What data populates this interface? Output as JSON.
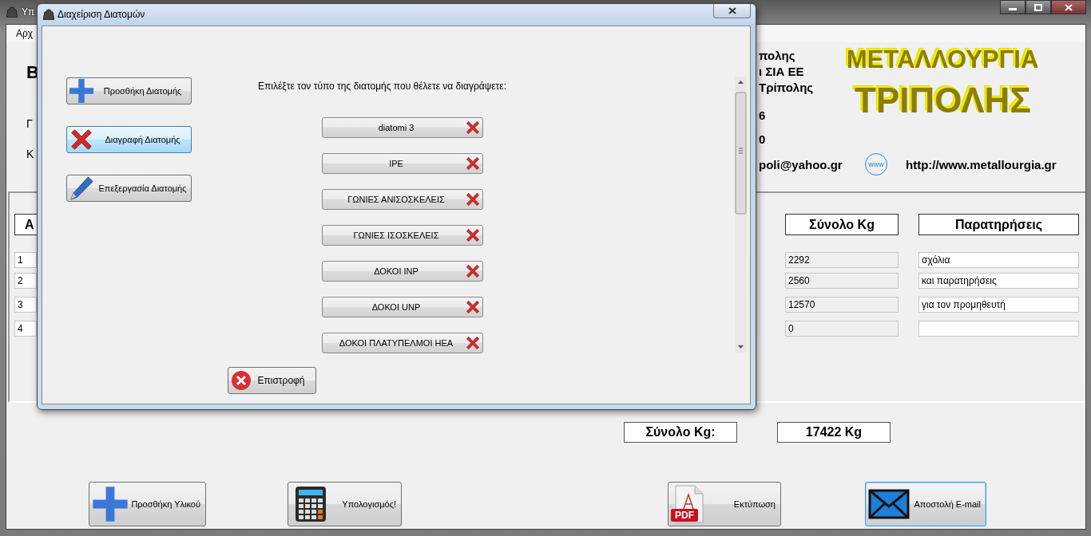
{
  "main_window": {
    "title": "Υπ",
    "menu": [
      "Αρχ"
    ],
    "header_letters": [
      "Β",
      "Γ",
      "Κ"
    ],
    "company_lines": [
      "πολης",
      "ι ΣΙΑ ΕΕ",
      "Τρίπολης",
      "6",
      "0"
    ],
    "email": "poli@yahoo.gr",
    "web_badge": "www",
    "website": "http://www.metallourgia.gr",
    "logo": [
      "ΜΕΤΑΛΛΟΥΡΓΙΑ",
      "ΤΡΙΠΟΛΗΣ"
    ]
  },
  "table": {
    "columns": [
      "Α",
      "Σύνολο Kg",
      "Παρατηρήσεις"
    ],
    "rows": [
      {
        "index": "1",
        "kg": "2292",
        "remarks": "σχόλια"
      },
      {
        "index": "2",
        "kg": "2560",
        "remarks": "και παρατηρήσεις"
      },
      {
        "index": "3",
        "kg": "12570",
        "remarks": "για τον προμηθευτή"
      },
      {
        "index": "4",
        "kg": "0"
      }
    ]
  },
  "totals": {
    "label": "Σύνολο Kg:",
    "value": "17422 Kg"
  },
  "buttons": [
    {
      "label": "Προσθήκη Υλικού",
      "kind": "add",
      "focused": false
    },
    {
      "label": "Υπολογισμός!",
      "kind": "calculate",
      "focused": false
    },
    {
      "label": "Εκτύπωση",
      "kind": "print",
      "badge": "PDF",
      "focused": false
    },
    {
      "label": "Αποστολή E-mail",
      "kind": "email",
      "focused": true
    }
  ],
  "dialog": {
    "title": "Διαχείριση Διατομών",
    "actions": [
      {
        "label": "Προσθήκη Διατομής",
        "kind": "add",
        "selected": false
      },
      {
        "label": "Διαγραφή Διατομής",
        "kind": "delete",
        "selected": true
      },
      {
        "label": "Επεξεργασία Διατομής",
        "kind": "edit",
        "selected": false
      }
    ],
    "prompt": "Επιλέξτε τον τύπο της διατομής που θέλετε να διαγράψετε:",
    "sections": [
      "diatomi 3",
      "IPE",
      "ΓΩΝΙΕΣ ΑΝΙΣΟΣΚΕΛΕΙΣ",
      "ΓΩΝΙΕΣ ΙΣΟΣΚΕΛΕΙΣ",
      "ΔΟΚΟΙ INP",
      "ΔΟΚΟΙ UNP",
      "ΔΟΚΟΙ ΠΛΑΤΥΠΕΛΜΟΙ ΗΕΑ"
    ],
    "back_button": {
      "label": "Επιστροφή"
    }
  }
}
